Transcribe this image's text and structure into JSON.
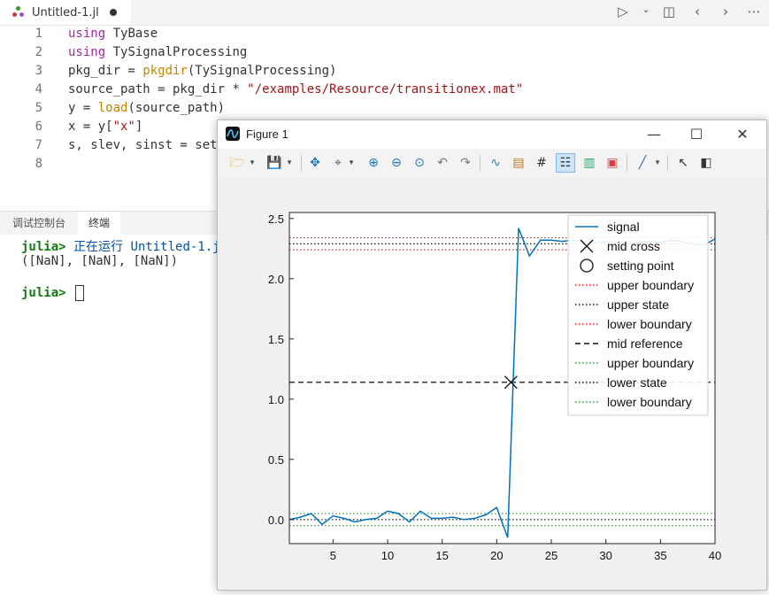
{
  "editor": {
    "tab_title": "Untitled-1.jl",
    "actions": [
      "run-icon",
      "chevron-down-icon",
      "split-editor-icon",
      "back-icon",
      "forward-icon",
      "more-icon"
    ],
    "lines": [
      {
        "num": "1",
        "parts": [
          {
            "t": "using",
            "c": "kw"
          },
          {
            "t": " TyBase",
            "c": ""
          }
        ]
      },
      {
        "num": "2",
        "parts": [
          {
            "t": "using",
            "c": "kw"
          },
          {
            "t": " TySignalProcessing",
            "c": ""
          }
        ]
      },
      {
        "num": "3",
        "parts": [
          {
            "t": "pkg_dir = ",
            "c": ""
          },
          {
            "t": "pkgdir",
            "c": "fn"
          },
          {
            "t": "(TySignalProcessing)",
            "c": ""
          }
        ]
      },
      {
        "num": "4",
        "parts": [
          {
            "t": "source_path = pkg_dir * ",
            "c": ""
          },
          {
            "t": "\"/examples/Resource/transitionex.mat\"",
            "c": "s2"
          }
        ]
      },
      {
        "num": "5",
        "parts": [
          {
            "t": "y = ",
            "c": ""
          },
          {
            "t": "load",
            "c": "fn"
          },
          {
            "t": "(source_path)",
            "c": ""
          }
        ]
      },
      {
        "num": "6",
        "parts": [
          {
            "t": "x = y[",
            "c": ""
          },
          {
            "t": "\"x\"",
            "c": "s2"
          },
          {
            "t": "]",
            "c": ""
          }
        ]
      },
      {
        "num": "7",
        "parts": [
          {
            "t": "s, slev, sinst = set",
            "c": ""
          }
        ]
      },
      {
        "num": "8",
        "parts": []
      }
    ]
  },
  "panel": {
    "tabs": [
      "调试控制台",
      "终端"
    ],
    "active_tab": "终端"
  },
  "terminal": {
    "prompt": "julia>",
    "running_text": "正在运行 Untitled-1.j",
    "output": "([NaN], [NaN], [NaN])"
  },
  "figure_window": {
    "title": "Figure 1",
    "minimize": "—",
    "maximize": "☐",
    "close": "✕"
  },
  "chart_data": {
    "type": "line",
    "xlim": [
      1,
      40
    ],
    "ylim": [
      -0.2,
      2.55
    ],
    "xticks": [
      5,
      10,
      15,
      20,
      25,
      30,
      35,
      40
    ],
    "yticks": [
      0.0,
      0.5,
      1.0,
      1.5,
      2.0,
      2.5
    ],
    "ytick_labels": [
      "0.0",
      "0.5",
      "1.0",
      "1.5",
      "2.0",
      "2.5"
    ],
    "grid": false,
    "legend_position": "top-right",
    "signal": {
      "name": "signal",
      "color": "#0072bd",
      "x": [
        1,
        2,
        3,
        4,
        5,
        6,
        7,
        8,
        9,
        10,
        11,
        12,
        13,
        14,
        15,
        16,
        17,
        18,
        19,
        20,
        21,
        22,
        23,
        24,
        25,
        26,
        27,
        28,
        29,
        30,
        31,
        32,
        33,
        34,
        35,
        36,
        37,
        38,
        39,
        40
      ],
      "y": [
        0.0,
        0.02,
        0.05,
        -0.04,
        0.03,
        0.01,
        -0.02,
        0.0,
        0.01,
        0.07,
        0.05,
        -0.02,
        0.07,
        0.01,
        0.01,
        0.02,
        0.0,
        0.01,
        0.04,
        0.1,
        -0.15,
        2.42,
        2.19,
        2.32,
        2.32,
        2.31,
        2.32,
        2.31,
        2.3,
        2.31,
        2.3,
        2.29,
        2.3,
        2.31,
        2.3,
        2.32,
        2.31,
        2.29,
        2.28,
        2.33
      ]
    },
    "mid_cross": {
      "name": "mid cross",
      "x": 21.3,
      "y": 1.14
    },
    "hlines": [
      {
        "name": "upper boundary",
        "y": 2.34,
        "style": "dotted",
        "color": "#e41a1c"
      },
      {
        "name": "upper state",
        "y": 2.29,
        "style": "dotted",
        "color": "#111111"
      },
      {
        "name": "lower boundary",
        "y": 2.24,
        "style": "dotted",
        "color": "#e41a1c"
      },
      {
        "name": "mid reference",
        "y": 1.14,
        "style": "dashed",
        "color": "#111111"
      },
      {
        "name": "upper boundary",
        "y": 0.05,
        "style": "dotted",
        "color": "#2ca02c"
      },
      {
        "name": "lower state",
        "y": 0.0,
        "style": "dotted",
        "color": "#111111"
      },
      {
        "name": "lower boundary",
        "y": -0.05,
        "style": "dotted",
        "color": "#2ca02c"
      }
    ],
    "legend": [
      {
        "label": "signal",
        "kind": "line",
        "color": "#0072bd",
        "style": "solid"
      },
      {
        "label": "mid cross",
        "kind": "x",
        "color": "#111111"
      },
      {
        "label": "setting point",
        "kind": "circle",
        "color": "#111111"
      },
      {
        "label": "upper boundary",
        "kind": "line",
        "color": "#e41a1c",
        "style": "dotted"
      },
      {
        "label": "upper state",
        "kind": "line",
        "color": "#111111",
        "style": "dotted"
      },
      {
        "label": "lower boundary",
        "kind": "line",
        "color": "#e41a1c",
        "style": "dotted"
      },
      {
        "label": "mid reference",
        "kind": "line",
        "color": "#111111",
        "style": "dashed"
      },
      {
        "label": "upper boundary",
        "kind": "line",
        "color": "#2ca02c",
        "style": "dotted"
      },
      {
        "label": "lower state",
        "kind": "line",
        "color": "#111111",
        "style": "dotted"
      },
      {
        "label": "lower boundary",
        "kind": "line",
        "color": "#2ca02c",
        "style": "dotted"
      }
    ]
  }
}
